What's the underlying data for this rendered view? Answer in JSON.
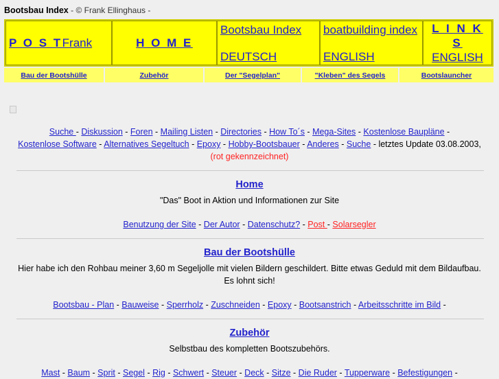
{
  "header": {
    "title": "Bootsbau Index",
    "byline": "- © Frank Ellinghaus -"
  },
  "main_nav": [
    {
      "name": "post-frank",
      "strong": "P O S T",
      "rest": "Frank",
      "style": "mixed"
    },
    {
      "name": "home",
      "label": "H O M E",
      "style": "spaced"
    },
    {
      "name": "bootsbau-index-deutsch",
      "line1": "Bootsbau Index",
      "line2": "DEUTSCH",
      "style": "two-line-left"
    },
    {
      "name": "boatbuilding-index-english",
      "line1": "boatbuilding index",
      "line2": "ENGLISH",
      "style": "two-line-left"
    },
    {
      "name": "links-english",
      "line1": "L I N K S",
      "line2": "ENGLISH",
      "style": "two-line-center-bold"
    }
  ],
  "sub_nav": [
    {
      "name": "bau-der-bootshuelle",
      "label": "Bau der Bootshülle"
    },
    {
      "name": "zubehoer",
      "label": "Zubehör"
    },
    {
      "name": "der-segelplan",
      "label": "Der \"Segelplan\""
    },
    {
      "name": "kleben-des-segels",
      "label": "\"Kleben\" des Segels"
    },
    {
      "name": "bootslauncher",
      "label": "Bootslauncher"
    }
  ],
  "link_bar": {
    "links": [
      "Suche ",
      "Diskussion",
      "Foren",
      "Mailing Listen",
      "Directories",
      "How To´s",
      "Mega-Sites",
      "Kostenlose Baupläne",
      "Kostenlose Software",
      "Alternatives Segeltuch",
      "Epoxy",
      "Hobby-Bootsbauer",
      "Anderes",
      "Suche"
    ],
    "separator": " - ",
    "update_text": " - letztes Update 03.08.2003, ",
    "update_note": "(rot gekennzeichnet)"
  },
  "sections": [
    {
      "name": "home",
      "heading": "Home",
      "description": "\"Das\" Boot in Aktion und Informationen zur Site",
      "links": [
        {
          "label": "Benutzung der Site",
          "red": false
        },
        {
          "label": "Der Autor",
          "red": false
        },
        {
          "label": "Datenschutz?",
          "red": false
        },
        {
          "label": "Post ",
          "red": true
        },
        {
          "label": "Solarsegler",
          "red": true
        }
      ],
      "trailing": ""
    },
    {
      "name": "bau-der-bootshuelle",
      "heading": "Bau der Bootshülle",
      "description": "Hier habe ich den Rohbau meiner 3,60 m Segeljolle mit vielen Bildern geschildert. Bitte etwas Geduld mit dem Bildaufbau. Es lohnt sich!",
      "links": [
        {
          "label": "Bootsbau - Plan",
          "red": false
        },
        {
          "label": "Bauweise",
          "red": false
        },
        {
          "label": "Sperrholz",
          "red": false
        },
        {
          "label": "Zuschneiden",
          "red": false
        },
        {
          "label": "Epoxy",
          "red": false
        },
        {
          "label": "Bootsanstrich",
          "red": false
        },
        {
          "label": "Arbeitsschritte im Bild",
          "red": false
        }
      ],
      "trailing": " -"
    },
    {
      "name": "zubehoer",
      "heading": "Zubehör",
      "description": "Selbstbau des kompletten Bootszubehörs.",
      "links": [
        {
          "label": "Mast",
          "red": false
        },
        {
          "label": "Baum",
          "red": false
        },
        {
          "label": "Sprit",
          "red": false
        },
        {
          "label": "Segel",
          "red": false
        },
        {
          "label": "Rig",
          "red": false
        },
        {
          "label": "Schwert",
          "red": false
        },
        {
          "label": "Steuer",
          "red": false
        },
        {
          "label": "Deck",
          "red": false
        },
        {
          "label": "Sitze",
          "red": false
        },
        {
          "label": "Die Ruder",
          "red": false
        },
        {
          "label": "Tupperware",
          "red": false
        },
        {
          "label": "Befestigungen",
          "red": false
        }
      ],
      "trailing": " -"
    }
  ],
  "colors": {
    "page_bg": "#efefef",
    "nav_cell": "#ffff00",
    "nav_border": "#cccc00",
    "subnav_cell": "#ffff66",
    "link": "#2222cc",
    "link_new": "#ff2222"
  }
}
